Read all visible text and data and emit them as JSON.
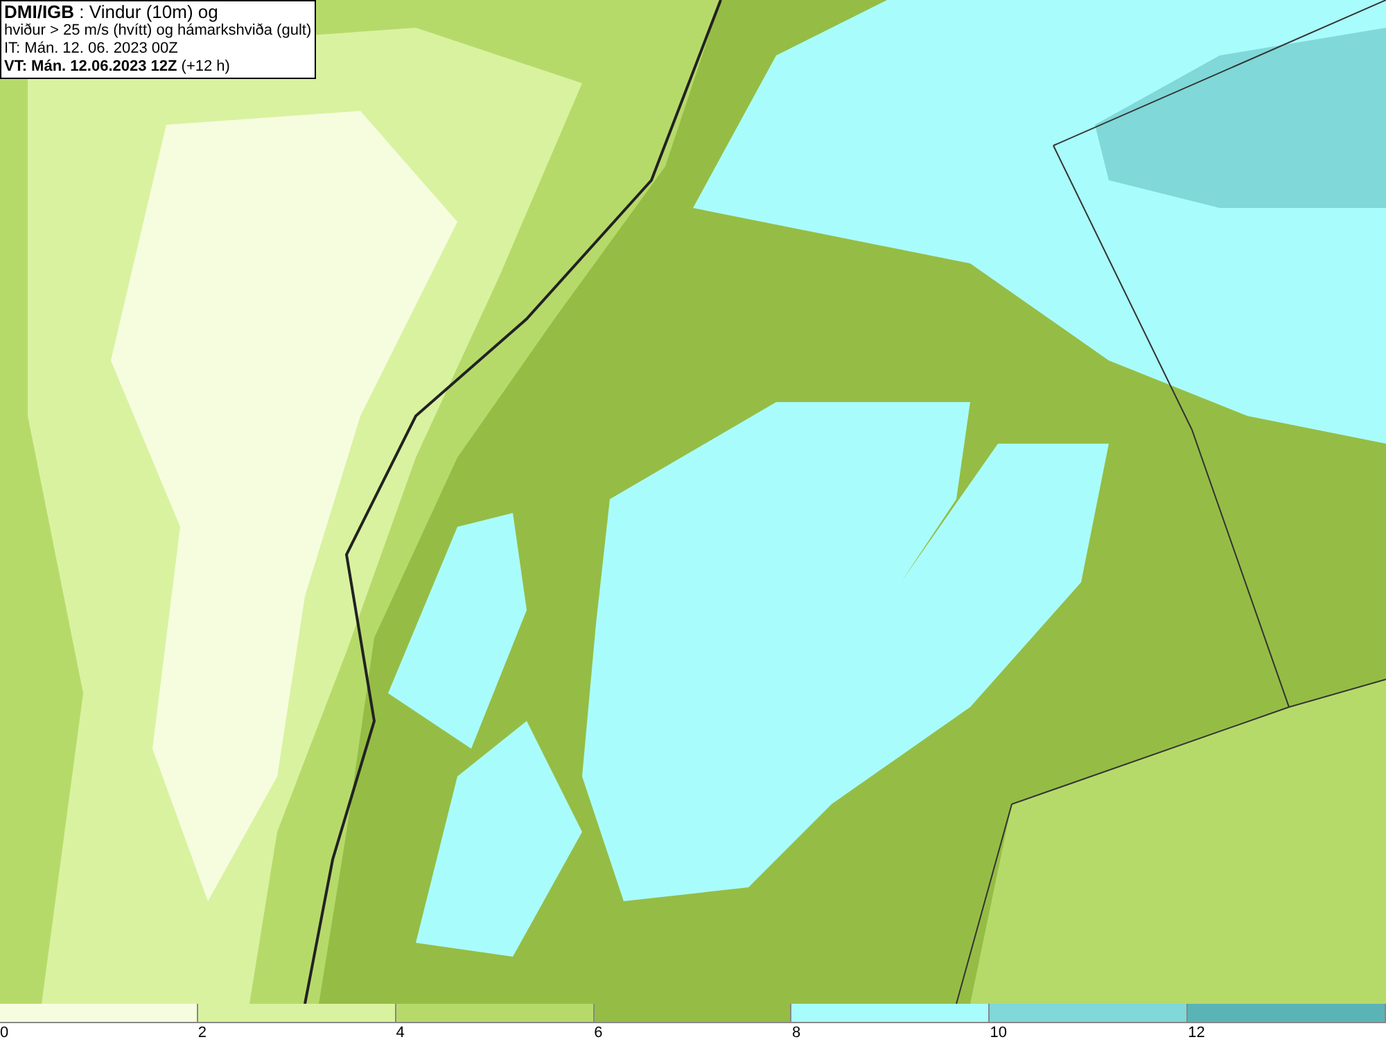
{
  "title_box": {
    "lines": [
      "**DMI/IGB** : Vindur (10m) og",
      "hviður > 25 m/s (hvítt) og hámarkshviða (gult)",
      "IT: Mán. 12. 06. 2023 00Z",
      "**VT: Mán. 12.06.2023 12Z** (+12 h)"
    ]
  },
  "legend": {
    "bins": [
      {
        "label": "0",
        "color": "#f6fddf"
      },
      {
        "label": "2",
        "color": "#d9f2a0"
      },
      {
        "label": "4",
        "color": "#b6da6a"
      },
      {
        "label": "6",
        "color": "#95bd45"
      },
      {
        "label": "8",
        "color": "#a9fcfc"
      },
      {
        "label": "10",
        "color": "#80d8d8"
      },
      {
        "label": "12",
        "color": "#5ab4b6"
      }
    ]
  }
}
